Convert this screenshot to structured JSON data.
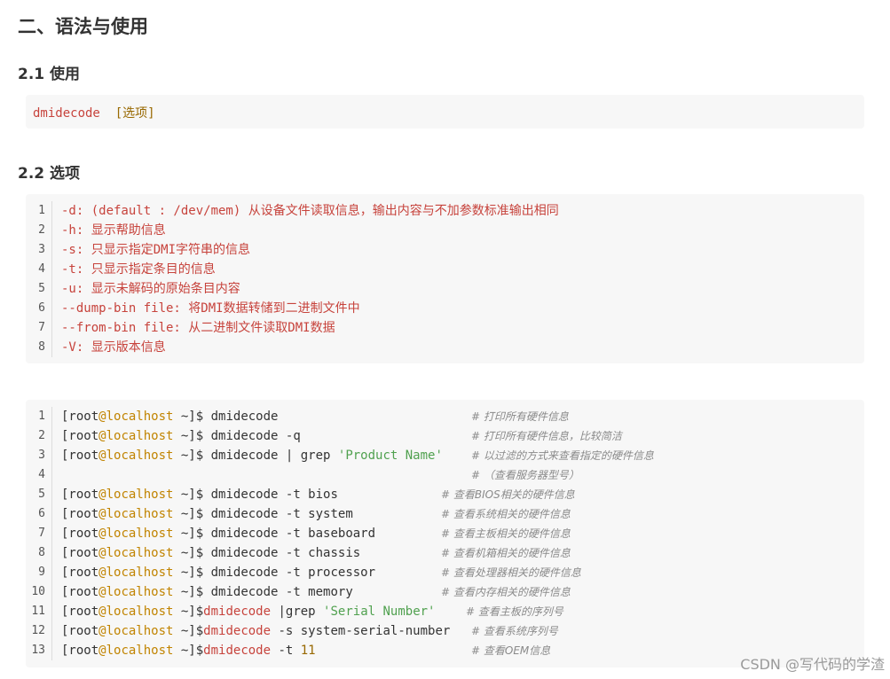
{
  "section_title": "二、语法与使用",
  "sub1": "2.1 使用",
  "usage": {
    "cmd": "dmidecode",
    "arg": "[选项]"
  },
  "sub2": "2.2 选项",
  "options": [
    {
      "n": "1",
      "text": "-d: (default : /dev/mem) 从设备文件读取信息，输出内容与不加参数标准输出相同"
    },
    {
      "n": "2",
      "text": "-h: 显示帮助信息"
    },
    {
      "n": "3",
      "text": "-s: 只显示指定DMI字符串的信息"
    },
    {
      "n": "4",
      "text": "-t: 只显示指定条目的信息"
    },
    {
      "n": "5",
      "text": "-u: 显示未解码的原始条目内容"
    },
    {
      "n": "6",
      "text": "--dump-bin file: 将DMI数据转储到二进制文件中"
    },
    {
      "n": "7",
      "text": "--from-bin file: 从二进制文件读取DMI数据"
    },
    {
      "n": "8",
      "text": "-V: 显示版本信息"
    }
  ],
  "prompt": {
    "open": "[root",
    "at": "@localhost",
    "close": " ~]$"
  },
  "commands": [
    {
      "n": "1",
      "prompt": true,
      "head": " dmidecode",
      "str": "",
      "num": "",
      "rest": "",
      "comment": "# 打印所有硬件信息"
    },
    {
      "n": "2",
      "prompt": true,
      "head": " dmidecode -q",
      "str": "",
      "num": "",
      "rest": "",
      "comment": "# 打印所有硬件信息，比较简洁"
    },
    {
      "n": "3",
      "prompt": true,
      "head": " dmidecode | grep ",
      "str": "'Product Name'",
      "num": "",
      "rest": "",
      "comment": "# 以过滤的方式来查看指定的硬件信息"
    },
    {
      "n": "4",
      "prompt": false,
      "head": "",
      "str": "",
      "num": "",
      "rest": "",
      "comment": "# （查看服务器型号）"
    },
    {
      "n": "5",
      "prompt": true,
      "head": " dmidecode -t bios",
      "str": "",
      "num": "",
      "rest": "",
      "comment": "# 查看BIOS相关的硬件信息"
    },
    {
      "n": "6",
      "prompt": true,
      "head": " dmidecode -t system",
      "str": "",
      "num": "",
      "rest": "",
      "comment": "# 查看系统相关的硬件信息"
    },
    {
      "n": "7",
      "prompt": true,
      "head": " dmidecode -t baseboard",
      "str": "",
      "num": "",
      "rest": "",
      "comment": "# 查看主板相关的硬件信息"
    },
    {
      "n": "8",
      "prompt": true,
      "head": " dmidecode -t chassis",
      "str": "",
      "num": "",
      "rest": "",
      "comment": "# 查看机箱相关的硬件信息"
    },
    {
      "n": "9",
      "prompt": true,
      "head": " dmidecode -t processor",
      "str": "",
      "num": "",
      "rest": "",
      "comment": "# 查看处理器相关的硬件信息"
    },
    {
      "n": "10",
      "prompt": true,
      "head": " dmidecode -t memory",
      "str": "",
      "num": "",
      "rest": "",
      "comment": "# 查看内存相关的硬件信息"
    },
    {
      "n": "11",
      "prompt": true,
      "headkw": "dmidecode",
      "head": " |grep ",
      "str": "'Serial Number'",
      "num": "",
      "rest": "",
      "comment": "# 查看主板的序列号"
    },
    {
      "n": "12",
      "prompt": true,
      "headkw": "dmidecode",
      "head": " -s system-serial-number",
      "str": "",
      "num": "",
      "rest": "",
      "comment": "# 查看系统序列号"
    },
    {
      "n": "13",
      "prompt": true,
      "headkw": "dmidecode",
      "head": " -t ",
      "str": "",
      "num": "11",
      "rest": "",
      "comment": "# 查看OEM信息"
    }
  ],
  "watermark": "CSDN @写代码的学渣"
}
